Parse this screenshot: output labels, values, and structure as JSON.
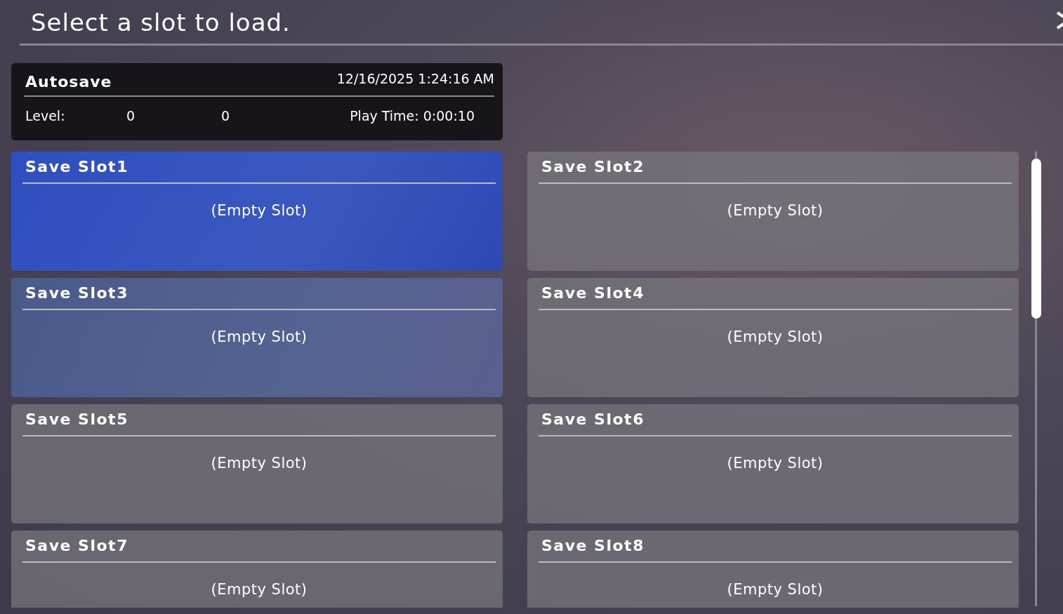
{
  "header": {
    "title": "Select a slot to load."
  },
  "autosave": {
    "name": "Autosave",
    "timestamp": "12/16/2025 1:24:16 AM",
    "level_label": "Level:",
    "values": [
      "0",
      "0"
    ],
    "play_time": "Play Time: 0:00:10"
  },
  "slots": [
    {
      "name": "Save Slot1",
      "status": "(Empty Slot)",
      "selected": true,
      "hovered": false
    },
    {
      "name": "Save Slot2",
      "status": "(Empty Slot)",
      "selected": false,
      "hovered": false
    },
    {
      "name": "Save Slot3",
      "status": "(Empty Slot)",
      "selected": false,
      "hovered": true
    },
    {
      "name": "Save Slot4",
      "status": "(Empty Slot)",
      "selected": false,
      "hovered": false
    },
    {
      "name": "Save Slot5",
      "status": "(Empty Slot)",
      "selected": false,
      "hovered": false
    },
    {
      "name": "Save Slot6",
      "status": "(Empty Slot)",
      "selected": false,
      "hovered": false
    },
    {
      "name": "Save Slot7",
      "status": "(Empty Slot)",
      "selected": false,
      "hovered": false
    },
    {
      "name": "Save Slot8",
      "status": "(Empty Slot)",
      "selected": false,
      "hovered": false
    }
  ]
}
